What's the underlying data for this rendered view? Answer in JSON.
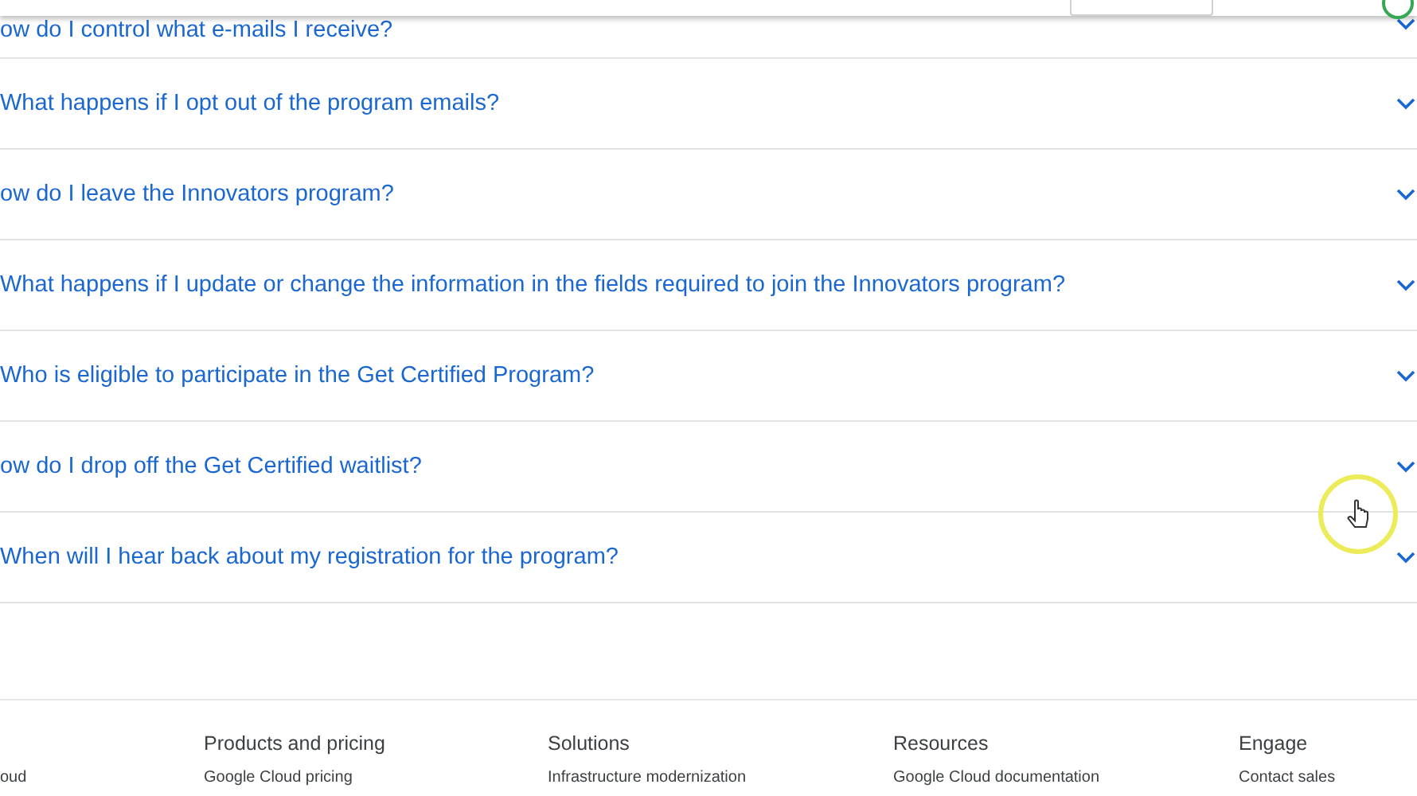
{
  "faq": [
    {
      "question": "ow do I control what e-mails I receive?",
      "expanded": false
    },
    {
      "question": "What happens if I opt out of the program emails?",
      "expanded": false
    },
    {
      "question": "ow do I leave the Innovators program?",
      "expanded": false
    },
    {
      "question": "What happens if I update or change the information in the fields required to join the Innovators program?",
      "expanded": false
    },
    {
      "question": "Who is eligible to participate in the Get Certified Program?",
      "expanded": false
    },
    {
      "question": "ow do I drop off the Get Certified waitlist?",
      "expanded": false
    },
    {
      "question": "When will I hear back about my registration for the program?",
      "expanded": false
    }
  ],
  "footer": {
    "columns": [
      {
        "links": [
          "oud"
        ]
      },
      {
        "heading": "Products and pricing",
        "links": [
          "Google Cloud pricing"
        ]
      },
      {
        "heading": "Solutions",
        "links": [
          "Infrastructure modernization"
        ]
      },
      {
        "heading": "Resources",
        "links": [
          "Google Cloud documentation"
        ]
      },
      {
        "heading": "Engage",
        "links": [
          "Contact sales"
        ]
      }
    ]
  }
}
